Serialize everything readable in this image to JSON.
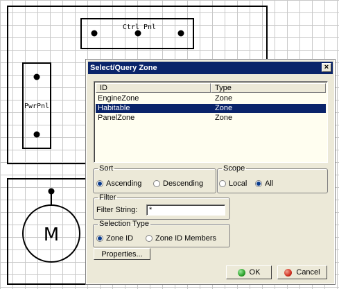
{
  "canvas": {
    "ctrl_panel_label": "Ctrl Pnl",
    "pwr_panel_label": "PwrPnl",
    "motor_label": "M"
  },
  "dialog": {
    "title": "Select/Query Zone",
    "close_label": "×",
    "table": {
      "columns": [
        "ID",
        "Type"
      ],
      "rows": [
        {
          "id": "EngineZone",
          "type": "Zone",
          "selected": false
        },
        {
          "id": "Habitable",
          "type": "Zone",
          "selected": true
        },
        {
          "id": "PanelZone",
          "type": "Zone",
          "selected": false
        }
      ]
    },
    "sort": {
      "legend": "Sort",
      "options": [
        {
          "label": "Ascending",
          "checked": true
        },
        {
          "label": "Descending",
          "checked": false
        }
      ]
    },
    "scope": {
      "legend": "Scope",
      "options": [
        {
          "label": "Local",
          "checked": false
        },
        {
          "label": "All",
          "checked": true
        }
      ]
    },
    "filter": {
      "legend": "Filter",
      "label": "Filter String:",
      "value": "*"
    },
    "selection_type": {
      "legend": "Selection Type",
      "options": [
        {
          "label": "Zone ID",
          "checked": true
        },
        {
          "label": "Zone ID Members",
          "checked": false
        }
      ]
    },
    "properties_label": "Properties...",
    "ok_label": "OK",
    "cancel_label": "Cancel"
  },
  "colors": {
    "titlebar": "#0a246a",
    "selection": "#0a246a",
    "ok_icon": "#2aa02a",
    "cancel_icon": "#d03020"
  }
}
